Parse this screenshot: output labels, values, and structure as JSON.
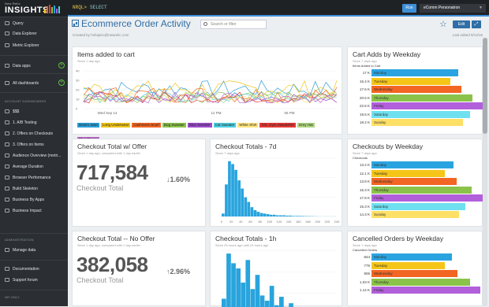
{
  "logo": {
    "brand": "New Relic",
    "product": "INSIGHTS"
  },
  "sidebar": {
    "items": [
      {
        "label": "Query"
      },
      {
        "label": "Data Explorer"
      },
      {
        "label": "Metric Explorer"
      },
      {
        "label": "Data apps"
      },
      {
        "label": "All dashboards"
      }
    ],
    "section_dash": "ACCOUNT DASHBOARDS",
    "dashboards": [
      "$$$",
      "1. A/B Testing",
      "2. Offers on Checkouts",
      "3. Offers on Items",
      "Audience Overview (metri...",
      "Average Duration",
      "Browser Performance",
      "Build Skeleton",
      "Business By Apps",
      "Business Impact"
    ],
    "section_admin": "ADMINISTRATION",
    "admin": [
      "Manage data"
    ],
    "help": [
      "Documentation",
      "Support forum"
    ],
    "section_nr": "NR ONLY"
  },
  "topbar": {
    "nrql": "NRQL>",
    "nrql_cmd": "SELECT",
    "run": "Run",
    "account": "eComm Personatron"
  },
  "header": {
    "title": "Ecommerce Order Activity",
    "created_by": "Created by hshapiro@newrelic.com",
    "search_placeholder": "Search or filter",
    "edit": "Edit",
    "fullscreen": "⤢",
    "star": "☆",
    "last_edited": "Last edited 9/14/16"
  },
  "cards": {
    "items_added": {
      "title": "Items added to cart",
      "sub": "Since 1 day ago",
      "xticks": [
        "Wed Sep 14",
        "12 PM",
        "06 PM"
      ],
      "yticks": [
        "40",
        "30",
        "20",
        "10",
        "0"
      ],
      "legend": [
        {
          "name": "Denim Jean",
          "color": "#2a9fd6"
        },
        {
          "name": "Long Underwear",
          "color": "#f0c419"
        },
        {
          "name": "Cashmere Scarf",
          "color": "#f26522"
        },
        {
          "name": "Dog Sweater",
          "color": "#8bc34a"
        },
        {
          "name": "Blue Sweater",
          "color": "#9c4dcc"
        },
        {
          "name": "Cat Sweater",
          "color": "#4dd0e1"
        },
        {
          "name": "White Shirt",
          "color": "#ffe57f"
        },
        {
          "name": "XXL Gym Sweatshirt",
          "color": "#e53935"
        },
        {
          "name": "Grey Hat",
          "color": "#aed581"
        },
        {
          "name": "Blue Blouse",
          "color": "#ba68c8"
        }
      ]
    },
    "cart_adds": {
      "title": "Cart Adds by Weekday",
      "sub": "Since 7 days ago",
      "label": "Items Added to Cart",
      "rows": [
        {
          "value": "17 K",
          "day": "Monday",
          "frac": 0.86,
          "color": "#2aa4e0"
        },
        {
          "value": "15.4 K",
          "day": "Tuesday",
          "frac": 0.78,
          "color": "#f5c518"
        },
        {
          "value": "17.6 K",
          "day": "Wednesday",
          "frac": 0.89,
          "color": "#f26522"
        },
        {
          "value": "20.5 K",
          "day": "Thursday",
          "frac": 1.0,
          "color": "#8bc34a"
        },
        {
          "value": "22.6 K",
          "day": "Friday",
          "frac": 1.1,
          "color": "#b25fdb"
        },
        {
          "value": "19.5 K",
          "day": "Saturday",
          "frac": 0.98,
          "color": "#6ee0f0"
        },
        {
          "value": "18.2 K",
          "day": "Sunday",
          "frac": 0.91,
          "color": "#ffe066"
        }
      ]
    },
    "checkout_total_offer": {
      "title": "Checkout Total w/ Offer",
      "sub": "Since 1 day ago, compared with 1 day earlier",
      "value": "717,584",
      "change": "1.60%",
      "direction": "down",
      "label": "Checkout Total"
    },
    "checkout_totals_7d": {
      "title": "Checkout Totals - 7d",
      "sub": "Since 7 days ago",
      "xticks": [
        "0",
        "20",
        "40",
        "60",
        "80",
        "100",
        "120",
        "140",
        "160",
        "180",
        "200",
        "220",
        "240"
      ]
    },
    "checkouts_weekday": {
      "title": "Checkouts by Weekday",
      "sub": "Since 7 days ago",
      "label": "Checkouts",
      "rows": [
        {
          "value": "13.4 K",
          "day": "Monday",
          "frac": 0.81,
          "color": "#2aa4e0"
        },
        {
          "value": "12.1 K",
          "day": "Tuesday",
          "frac": 0.73,
          "color": "#f5c518"
        },
        {
          "value": "13.8 K",
          "day": "Wednesday",
          "frac": 0.84,
          "color": "#f26522"
        },
        {
          "value": "16.3 K",
          "day": "Thursday",
          "frac": 0.99,
          "color": "#8bc34a"
        },
        {
          "value": "17.8 K",
          "day": "Friday",
          "frac": 1.1,
          "color": "#b25fdb"
        },
        {
          "value": "15.3 K",
          "day": "Saturday",
          "frac": 0.93,
          "color": "#6ee0f0"
        },
        {
          "value": "14.3 K",
          "day": "Sunday",
          "frac": 0.87,
          "color": "#ffe066"
        }
      ]
    },
    "checkout_total_nooffer": {
      "title": "Checkout Total -- No Offer",
      "sub": "Since 1 day ago, compared with 1 day earlier",
      "value": "382,058",
      "change": "2.96%",
      "direction": "up",
      "label": "Checkout Total"
    },
    "checkout_totals_1h": {
      "title": "Checkout Totals - 1h",
      "sub": "Since 25 hours ago until 24 hours ago"
    },
    "cancelled": {
      "title": "Cancelled Orders by Weekday",
      "sub": "Since 7 days ago",
      "label": "Cancelled Orders",
      "rows": [
        {
          "value": "844",
          "day": "Monday",
          "frac": 0.8,
          "color": "#2aa4e0"
        },
        {
          "value": "779",
          "day": "Tuesday",
          "frac": 0.73,
          "color": "#f5c518"
        },
        {
          "value": "906",
          "day": "Wednesday",
          "frac": 0.85,
          "color": "#f26522"
        },
        {
          "value": "1.03 K",
          "day": "Thursday",
          "frac": 0.98,
          "color": "#8bc34a"
        },
        {
          "value": "1.14 K",
          "day": "Friday",
          "frac": 1.08,
          "color": "#b25fdb"
        }
      ]
    }
  }
}
